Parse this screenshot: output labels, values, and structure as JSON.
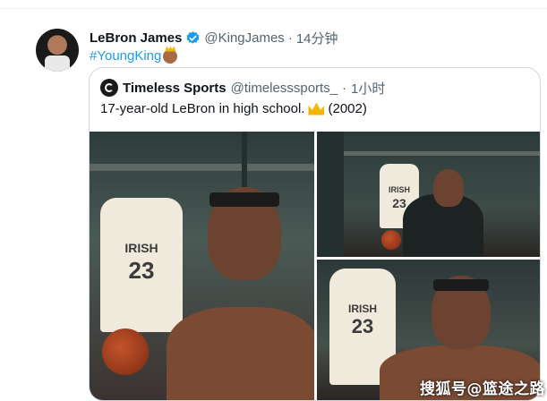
{
  "tweet": {
    "author_name": "LeBron James",
    "handle": "@KingJames",
    "separator": "·",
    "time": "14分钟",
    "hashtag": "#YoungKing",
    "emoji_icon": "king-emoji-icon",
    "verified_color": "#1d9bf0"
  },
  "quoted": {
    "author_name": "Timeless Sports",
    "handle": "@timelesssports_",
    "separator": "·",
    "time": "1小时",
    "text": "17-year-old LeBron in high school.",
    "text_suffix": "(2002)",
    "emoji_icon": "crown-icon",
    "photos": {
      "jersey_lettering": "IRISH",
      "jersey_number": "23"
    }
  },
  "watermark": "搜狐号@篮途之路"
}
